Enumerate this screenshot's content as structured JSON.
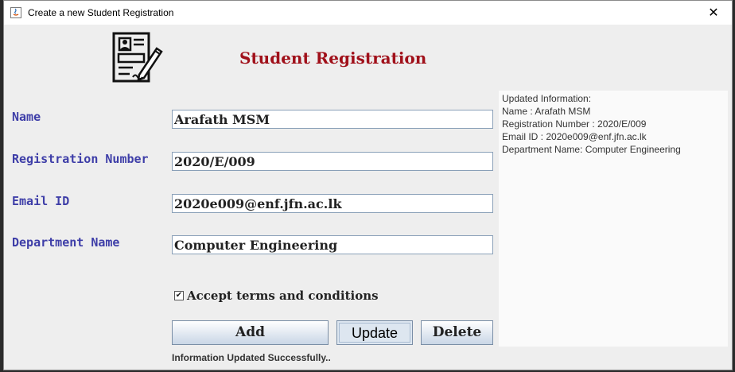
{
  "window": {
    "title": "Create a new Student Registration",
    "close_glyph": "✕"
  },
  "header": {
    "heading": "Student Registration",
    "logo_icon": "registration-form-icon"
  },
  "form": {
    "name_label": "Name",
    "name_value": "Arafath MSM",
    "reg_label": "Registration Number",
    "reg_value": "2020/E/009",
    "email_label": "Email ID",
    "email_value": "2020e009@enf.jfn.ac.lk",
    "dept_label": "Department Name",
    "dept_value": "Computer Engineering",
    "terms_label": "Accept terms and conditions",
    "terms_checked": true,
    "check_glyph": "✔"
  },
  "buttons": {
    "add": "Add",
    "update": "Update",
    "delete": "Delete"
  },
  "status": "Information Updated Successfully..",
  "info_panel": {
    "lines": [
      "Updated Information:",
      "Name : Arafath MSM",
      "Registration Number : 2020/E/009",
      "Email ID : 2020e009@enf.jfn.ac.lk",
      "Department Name: Computer Engineering"
    ]
  },
  "colors": {
    "heading": "#a0101a",
    "label": "#3e3ea8"
  }
}
